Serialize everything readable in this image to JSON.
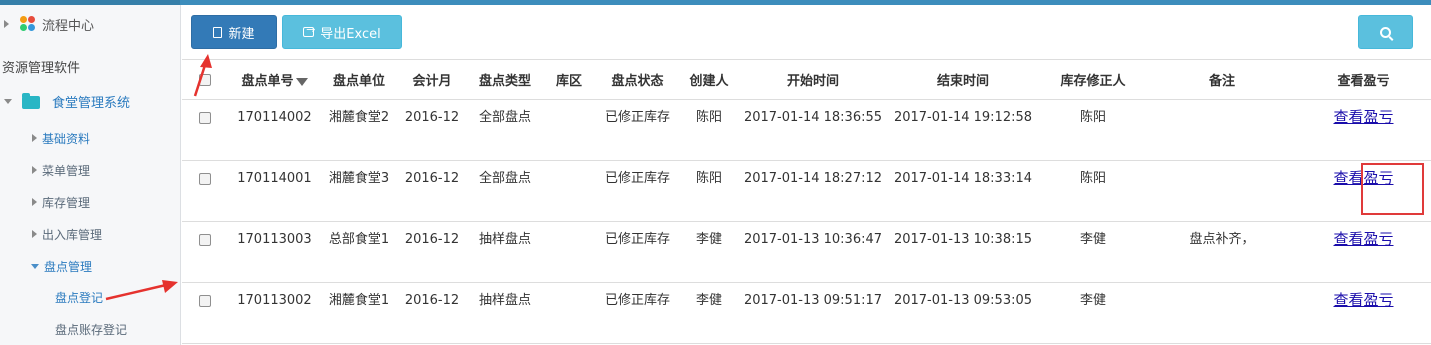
{
  "sidebar": {
    "top_item": "流程中心",
    "section_title": "资源管理软件",
    "system": "食堂管理系统",
    "groups": [
      {
        "label": "基础资料"
      },
      {
        "label": "菜单管理"
      },
      {
        "label": "库存管理"
      },
      {
        "label": "出入库管理"
      },
      {
        "label": "盘点管理"
      }
    ],
    "sub_items": [
      {
        "label": "盘点登记"
      },
      {
        "label": "盘点账存登记"
      }
    ]
  },
  "toolbar": {
    "new_label": "新建",
    "export_label": "导出Excel"
  },
  "table": {
    "headers": [
      "",
      "盘点单号",
      "盘点单位",
      "会计月",
      "盘点类型",
      "库区",
      "盘点状态",
      "创建人",
      "开始时间",
      "结束时间",
      "库存修正人",
      "备注",
      "查看盈亏"
    ],
    "rows": [
      {
        "no": "170114002",
        "unit": "湘麓食堂2",
        "month": "2016-12",
        "type": "全部盘点",
        "area": "",
        "status": "已修正库存",
        "creator": "陈阳",
        "start": "2017-01-14 18:36:55",
        "end": "2017-01-14 19:12:58",
        "fixer": "陈阳",
        "remark": "",
        "link": "查看盈亏"
      },
      {
        "no": "170114001",
        "unit": "湘麓食堂3",
        "month": "2016-12",
        "type": "全部盘点",
        "area": "",
        "status": "已修正库存",
        "creator": "陈阳",
        "start": "2017-01-14 18:27:12",
        "end": "2017-01-14 18:33:14",
        "fixer": "陈阳",
        "remark": "",
        "link": "查看盈亏"
      },
      {
        "no": "170113003",
        "unit": "总部食堂1",
        "month": "2016-12",
        "type": "抽样盘点",
        "area": "",
        "status": "已修正库存",
        "creator": "李健",
        "start": "2017-01-13 10:36:47",
        "end": "2017-01-13 10:38:15",
        "fixer": "李健",
        "remark": "盘点补齐，",
        "link": "查看盈亏"
      },
      {
        "no": "170113002",
        "unit": "湘麓食堂1",
        "month": "2016-12",
        "type": "抽样盘点",
        "area": "",
        "status": "已修正库存",
        "creator": "李健",
        "start": "2017-01-13 09:51:17",
        "end": "2017-01-13 09:53:05",
        "fixer": "李健",
        "remark": "",
        "link": "查看盈亏"
      }
    ]
  },
  "colors": {
    "primary": "#337ab7",
    "info": "#5bc0de",
    "link": "#1a0dab",
    "highlight": "#e03a3a",
    "annotation_arrow": "#e5322e"
  }
}
